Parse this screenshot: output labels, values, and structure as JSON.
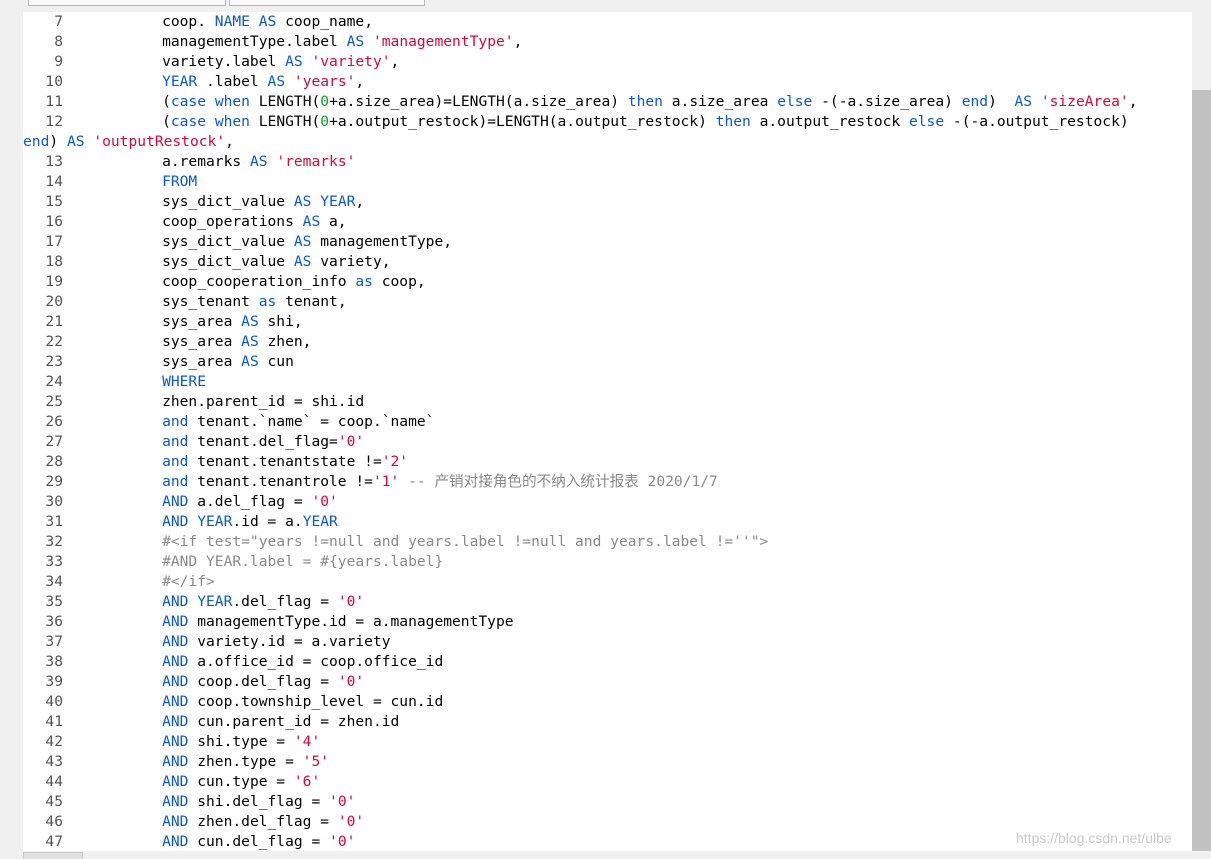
{
  "editor": {
    "lines": [
      {
        "n": "7",
        "tokens": [
          [
            "",
            "         coop. "
          ],
          [
            "kw",
            "NAME"
          ],
          [
            "",
            " "
          ],
          [
            "kw",
            "AS"
          ],
          [
            "",
            " coop_name,"
          ]
        ]
      },
      {
        "n": "8",
        "tokens": [
          [
            "",
            "         managementType.label "
          ],
          [
            "kw",
            "AS"
          ],
          [
            "",
            " "
          ],
          [
            "str",
            "'managementType'"
          ],
          [
            "",
            ","
          ]
        ]
      },
      {
        "n": "9",
        "tokens": [
          [
            "",
            "         variety.label "
          ],
          [
            "kw",
            "AS"
          ],
          [
            "",
            " "
          ],
          [
            "str",
            "'variety'"
          ],
          [
            "",
            ","
          ]
        ]
      },
      {
        "n": "10",
        "tokens": [
          [
            "",
            "         "
          ],
          [
            "kw",
            "YEAR"
          ],
          [
            "",
            " .label "
          ],
          [
            "kw",
            "AS"
          ],
          [
            "",
            " "
          ],
          [
            "str",
            "'years'"
          ],
          [
            "",
            ","
          ]
        ]
      },
      {
        "n": "11",
        "tokens": [
          [
            "",
            "         ("
          ],
          [
            "kw",
            "case"
          ],
          [
            "",
            " "
          ],
          [
            "kw",
            "when"
          ],
          [
            "",
            " LENGTH("
          ],
          [
            "num",
            "0"
          ],
          [
            "",
            "+a.size_area)=LENGTH(a.size_area) "
          ],
          [
            "kw",
            "then"
          ],
          [
            "",
            " a.size_area "
          ],
          [
            "kw",
            "else"
          ],
          [
            "",
            " -(-a.size_area) "
          ],
          [
            "kw",
            "end"
          ],
          [
            "",
            ")  "
          ],
          [
            "kw",
            "AS"
          ],
          [
            "",
            " "
          ],
          [
            "str",
            "'sizeArea'"
          ],
          [
            "",
            ","
          ]
        ]
      },
      {
        "n": "12",
        "tokens": [
          [
            "",
            "         ("
          ],
          [
            "kw",
            "case"
          ],
          [
            "",
            " "
          ],
          [
            "kw",
            "when"
          ],
          [
            "",
            " LENGTH("
          ],
          [
            "num",
            "0"
          ],
          [
            "",
            "+a.output_restock)=LENGTH(a.output_restock) "
          ],
          [
            "kw",
            "then"
          ],
          [
            "",
            " a.output_restock "
          ],
          [
            "kw",
            "else"
          ],
          [
            "",
            " -(-a.output_restock)"
          ]
        ]
      },
      {
        "n": "",
        "tokens": [
          [
            "kw",
            "end"
          ],
          [
            "",
            ") "
          ],
          [
            "kw",
            "AS"
          ],
          [
            "",
            " "
          ],
          [
            "str",
            "'outputRestock'"
          ],
          [
            "",
            ","
          ]
        ]
      },
      {
        "n": "13",
        "tokens": [
          [
            "",
            "         a.remarks "
          ],
          [
            "kw",
            "AS"
          ],
          [
            "",
            " "
          ],
          [
            "str",
            "'remarks'"
          ]
        ]
      },
      {
        "n": "14",
        "tokens": [
          [
            "",
            "         "
          ],
          [
            "kw",
            "FROM"
          ]
        ]
      },
      {
        "n": "15",
        "tokens": [
          [
            "",
            "         sys_dict_value "
          ],
          [
            "kw",
            "AS"
          ],
          [
            "",
            " "
          ],
          [
            "kw",
            "YEAR"
          ],
          [
            "",
            ","
          ]
        ]
      },
      {
        "n": "16",
        "tokens": [
          [
            "",
            "         coop_operations "
          ],
          [
            "kw",
            "AS"
          ],
          [
            "",
            " a,"
          ]
        ]
      },
      {
        "n": "17",
        "tokens": [
          [
            "",
            "         sys_dict_value "
          ],
          [
            "kw",
            "AS"
          ],
          [
            "",
            " managementType,"
          ]
        ]
      },
      {
        "n": "18",
        "tokens": [
          [
            "",
            "         sys_dict_value "
          ],
          [
            "kw",
            "AS"
          ],
          [
            "",
            " variety,"
          ]
        ]
      },
      {
        "n": "19",
        "tokens": [
          [
            "",
            "         coop_cooperation_info "
          ],
          [
            "kw",
            "as"
          ],
          [
            "",
            " coop,"
          ]
        ]
      },
      {
        "n": "20",
        "tokens": [
          [
            "",
            "         sys_tenant "
          ],
          [
            "kw",
            "as"
          ],
          [
            "",
            " tenant,"
          ]
        ]
      },
      {
        "n": "21",
        "tokens": [
          [
            "",
            "         sys_area "
          ],
          [
            "kw",
            "AS"
          ],
          [
            "",
            " shi,"
          ]
        ]
      },
      {
        "n": "22",
        "tokens": [
          [
            "",
            "         sys_area "
          ],
          [
            "kw",
            "AS"
          ],
          [
            "",
            " zhen,"
          ]
        ]
      },
      {
        "n": "23",
        "tokens": [
          [
            "",
            "         sys_area "
          ],
          [
            "kw",
            "AS"
          ],
          [
            "",
            " cun"
          ]
        ]
      },
      {
        "n": "24",
        "tokens": [
          [
            "",
            "         "
          ],
          [
            "kw",
            "WHERE"
          ]
        ]
      },
      {
        "n": "25",
        "tokens": [
          [
            "",
            "         zhen.parent_id = shi.id"
          ]
        ]
      },
      {
        "n": "26",
        "tokens": [
          [
            "",
            "         "
          ],
          [
            "kw",
            "and"
          ],
          [
            "",
            " tenant.`name` = coop.`name`"
          ]
        ]
      },
      {
        "n": "27",
        "tokens": [
          [
            "",
            "         "
          ],
          [
            "kw",
            "and"
          ],
          [
            "",
            " tenant.del_flag="
          ],
          [
            "str",
            "'0'"
          ]
        ]
      },
      {
        "n": "28",
        "tokens": [
          [
            "",
            "         "
          ],
          [
            "kw",
            "and"
          ],
          [
            "",
            " tenant.tenantstate !="
          ],
          [
            "str",
            "'2'"
          ]
        ]
      },
      {
        "n": "29",
        "tokens": [
          [
            "",
            "         "
          ],
          [
            "kw",
            "and"
          ],
          [
            "",
            " tenant.tenantrole !="
          ],
          [
            "str",
            "'1'"
          ],
          [
            "cm",
            " -- 产销对接角色的不纳入统计报表 2020/1/7"
          ]
        ]
      },
      {
        "n": "30",
        "tokens": [
          [
            "",
            "         "
          ],
          [
            "kw",
            "AND"
          ],
          [
            "",
            " a.del_flag = "
          ],
          [
            "str",
            "'0'"
          ]
        ]
      },
      {
        "n": "31",
        "tokens": [
          [
            "",
            "         "
          ],
          [
            "kw",
            "AND"
          ],
          [
            "",
            " "
          ],
          [
            "kw",
            "YEAR"
          ],
          [
            "",
            ".id = a."
          ],
          [
            "kw",
            "YEAR"
          ]
        ]
      },
      {
        "n": "32",
        "tokens": [
          [
            "cm",
            "         #<if test=\"years !=null and years.label !=null and years.label !=''\">"
          ]
        ]
      },
      {
        "n": "33",
        "tokens": [
          [
            "cm",
            "         #AND YEAR.label = #{years.label}"
          ]
        ]
      },
      {
        "n": "34",
        "tokens": [
          [
            "cm",
            "         #</if>"
          ]
        ]
      },
      {
        "n": "35",
        "tokens": [
          [
            "",
            "         "
          ],
          [
            "kw",
            "AND"
          ],
          [
            "",
            " "
          ],
          [
            "kw",
            "YEAR"
          ],
          [
            "",
            ".del_flag = "
          ],
          [
            "str",
            "'0'"
          ]
        ]
      },
      {
        "n": "36",
        "tokens": [
          [
            "",
            "         "
          ],
          [
            "kw",
            "AND"
          ],
          [
            "",
            " managementType.id = a.managementType"
          ]
        ]
      },
      {
        "n": "37",
        "tokens": [
          [
            "",
            "         "
          ],
          [
            "kw",
            "AND"
          ],
          [
            "",
            " variety.id = a.variety"
          ]
        ]
      },
      {
        "n": "38",
        "tokens": [
          [
            "",
            "         "
          ],
          [
            "kw",
            "AND"
          ],
          [
            "",
            " a.office_id = coop.office_id"
          ]
        ]
      },
      {
        "n": "39",
        "tokens": [
          [
            "",
            "         "
          ],
          [
            "kw",
            "AND"
          ],
          [
            "",
            " coop.del_flag = "
          ],
          [
            "str",
            "'0'"
          ]
        ]
      },
      {
        "n": "40",
        "tokens": [
          [
            "",
            "         "
          ],
          [
            "kw",
            "AND"
          ],
          [
            "",
            " coop.township_level = cun.id"
          ]
        ]
      },
      {
        "n": "41",
        "tokens": [
          [
            "",
            "         "
          ],
          [
            "kw",
            "AND"
          ],
          [
            "",
            " cun.parent_id = zhen.id"
          ]
        ]
      },
      {
        "n": "42",
        "tokens": [
          [
            "",
            "         "
          ],
          [
            "kw",
            "AND"
          ],
          [
            "",
            " shi.type = "
          ],
          [
            "str",
            "'4'"
          ]
        ]
      },
      {
        "n": "43",
        "tokens": [
          [
            "",
            "         "
          ],
          [
            "kw",
            "AND"
          ],
          [
            "",
            " zhen.type = "
          ],
          [
            "str",
            "'5'"
          ]
        ]
      },
      {
        "n": "44",
        "tokens": [
          [
            "",
            "         "
          ],
          [
            "kw",
            "AND"
          ],
          [
            "",
            " cun.type = "
          ],
          [
            "str",
            "'6'"
          ]
        ]
      },
      {
        "n": "45",
        "tokens": [
          [
            "",
            "         "
          ],
          [
            "kw",
            "AND"
          ],
          [
            "",
            " shi.del_flag = "
          ],
          [
            "str",
            "'0'"
          ]
        ]
      },
      {
        "n": "46",
        "tokens": [
          [
            "",
            "         "
          ],
          [
            "kw",
            "AND"
          ],
          [
            "",
            " zhen.del_flag = "
          ],
          [
            "str",
            "'0'"
          ]
        ]
      },
      {
        "n": "47",
        "tokens": [
          [
            "",
            "         "
          ],
          [
            "kw",
            "AND"
          ],
          [
            "",
            " cun.del_flag = "
          ],
          [
            "str",
            "'0'"
          ]
        ]
      }
    ]
  },
  "watermark": "https://blog.csdn.net/ulbe",
  "colors": {
    "keyword": "#0a57d6",
    "string": "#d8063b",
    "number": "#0c9f2c",
    "comment": "#8a8a8a"
  }
}
